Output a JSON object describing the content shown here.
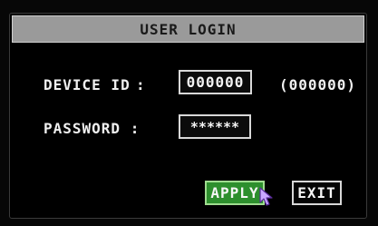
{
  "dialog": {
    "title": "USER LOGIN"
  },
  "fields": {
    "device_id_label": "DEVICE ID",
    "device_id_value": "000000",
    "device_id_hint": "(000000)",
    "password_label": "PASSWORD :",
    "password_value": "******"
  },
  "buttons": {
    "apply_label": "APPLY",
    "exit_label": "EXIT"
  },
  "icons": {
    "cursor": "mouse-pointer-icon"
  },
  "colors": {
    "apply_bg": "#2d8f2d",
    "title_bar_bg": "#9a9a9a"
  }
}
